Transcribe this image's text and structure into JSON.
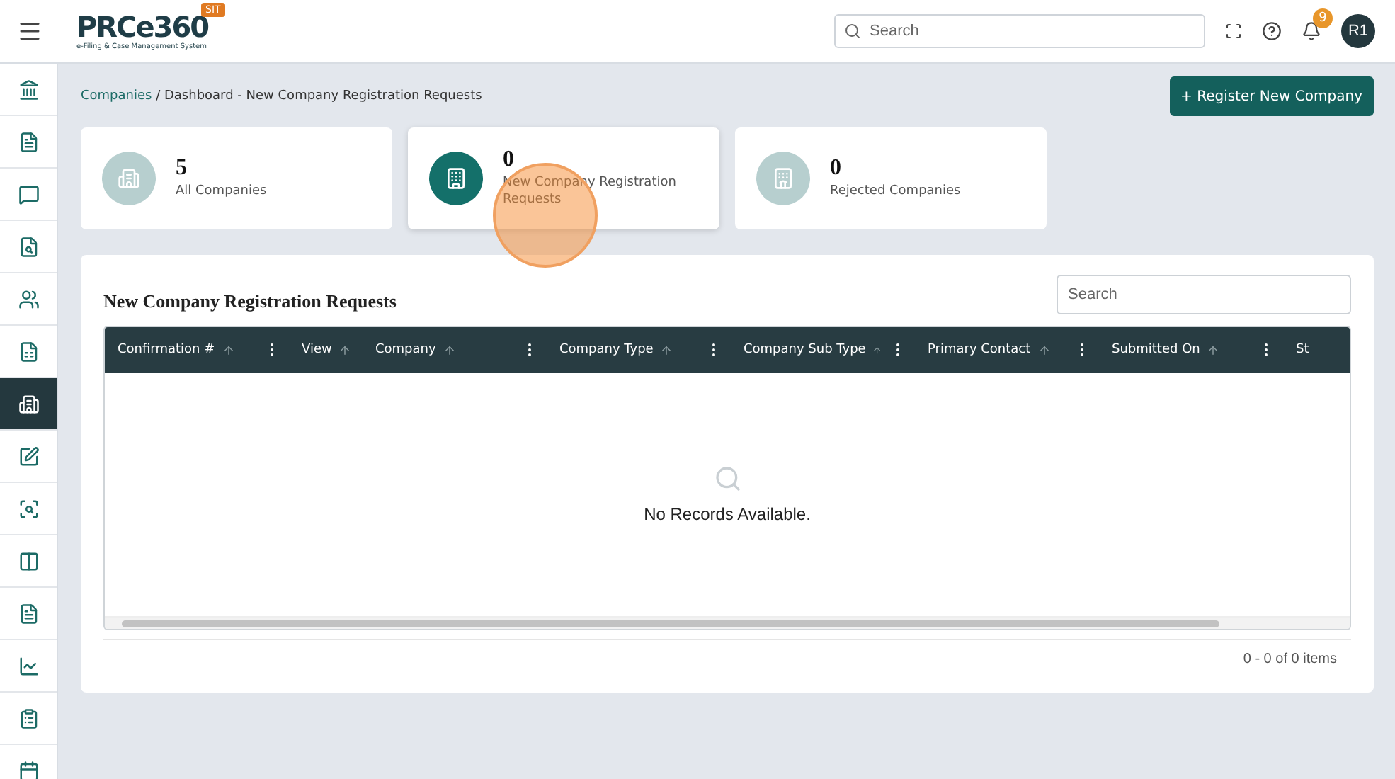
{
  "header": {
    "logo": "PRCe360",
    "logo_tagline": "e-Filing & Case Management System",
    "env_badge": "SIT",
    "search": {
      "placeholder": "Search"
    },
    "notification_count": "9",
    "avatar": "R1"
  },
  "sidebar": {
    "items": [
      {
        "kind": "bank",
        "selected": false
      },
      {
        "kind": "document",
        "selected": false
      },
      {
        "kind": "message",
        "selected": false
      },
      {
        "kind": "file-search",
        "selected": false
      },
      {
        "kind": "users",
        "selected": false
      },
      {
        "kind": "invoice",
        "selected": false
      },
      {
        "kind": "building",
        "selected": true
      },
      {
        "kind": "text",
        "selected": false
      },
      {
        "kind": "scan",
        "selected": false
      },
      {
        "kind": "columns",
        "selected": false
      },
      {
        "kind": "document",
        "selected": false
      },
      {
        "kind": "chart",
        "selected": false
      },
      {
        "kind": "clipboard",
        "selected": false
      },
      {
        "kind": "calendar",
        "selected": false
      }
    ]
  },
  "breadcrumb": {
    "link": "Companies",
    "current": "/ Dashboard - New Company Registration Requests"
  },
  "register_button": "+ Register New Company",
  "stat_cards": [
    {
      "kind": "all",
      "count": "5",
      "label": "All Companies",
      "selected": false
    },
    {
      "kind": "new",
      "count": "0",
      "label": "New Company Registration Requests",
      "selected": true
    },
    {
      "kind": "rejected",
      "count": "0",
      "label": "Rejected Companies",
      "selected": false
    }
  ],
  "table": {
    "title": "New Company Registration Requests",
    "search": {
      "placeholder": "Search"
    },
    "columns": [
      {
        "label": "Confirmation #",
        "menu": true
      },
      {
        "label": "View",
        "menu": false
      },
      {
        "label": "Company",
        "menu": true
      },
      {
        "label": "Company Type",
        "menu": true
      },
      {
        "label": "Company Sub Type",
        "menu": true
      },
      {
        "label": "Primary Contact",
        "menu": true
      },
      {
        "label": "Submitted On",
        "menu": true
      },
      {
        "label": "St"
      }
    ],
    "empty_message": "No Records Available.",
    "pager": "0 - 0 of 0 items"
  }
}
